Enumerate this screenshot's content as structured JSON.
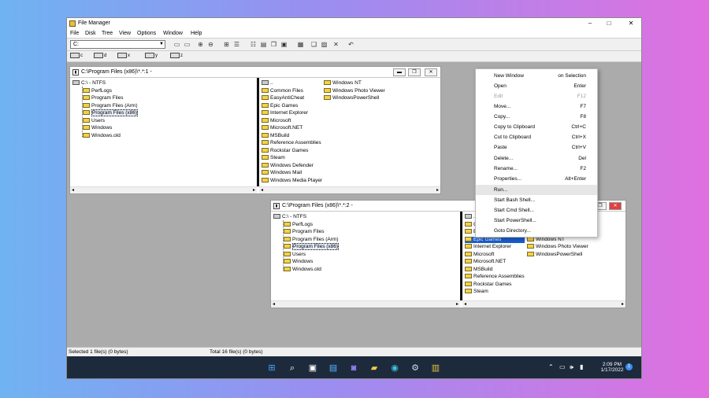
{
  "window": {
    "title": "File Manager",
    "controls": {
      "minimize": "–",
      "maximize": "□",
      "close": "✕"
    }
  },
  "menubar": [
    "File",
    "Disk",
    "Tree",
    "View",
    "Options",
    "Window",
    "Help"
  ],
  "toolbar": {
    "drive_value": "C:",
    "buttons": [
      "drive-connect-icon",
      "drive-disconnect-icon",
      "network-connect-icon",
      "network-disconnect-icon",
      "tree-view-icon",
      "split-view-icon",
      "list-view-icon",
      "details-view-icon",
      "copy-icon",
      "move-icon",
      "rename-icon",
      "delete-icon",
      "undo-icon"
    ]
  },
  "drives": [
    "c",
    "d",
    "x",
    "y",
    "z"
  ],
  "window1": {
    "title": "C:\\Program Files (x86)\\*.*:1 -",
    "tree_root": "C:\\ - NTFS",
    "tree": [
      "PerfLogs",
      "Program Files",
      "Program Files (Arm)",
      "Program Files (x86)",
      "Users",
      "Windows",
      "Windows.old"
    ],
    "selected_tree": "Program Files (x86)",
    "files_col1": [
      "..",
      "Common Files",
      "EasyAntiCheat",
      "Epic Games",
      "Internet Explorer",
      "Microsoft",
      "Microsoft.NET",
      "MSBuild",
      "Reference Assemblies",
      "Rockstar Games",
      "Steam",
      "Windows Defender",
      "Windows Mail",
      "Windows Media Player"
    ],
    "files_col2": [
      "Windows NT",
      "Windows Photo Viewer",
      "WindowsPowerShell"
    ]
  },
  "window2": {
    "title": "C:\\Program Files (x86)\\*.*:2 -",
    "tree_root": "C:\\ - NTFS",
    "tree": [
      "PerfLogs",
      "Program Files",
      "Program Files (Arm)",
      "Program Files (x86)",
      "Users",
      "Windows",
      "Windows.old"
    ],
    "selected_tree": "Program Files (x86)",
    "files_col1": [
      "..",
      "C",
      "E",
      "Epic Games",
      "Internet Explorer",
      "Microsoft",
      "Microsoft.NET",
      "MSBuild",
      "Reference Assemblies",
      "Rockstar Games",
      "Steam"
    ],
    "highlighted_file": "Epic Games",
    "files_col2": [
      "Windows NT",
      "Windows Photo Viewer",
      "WindowsPowerShell"
    ]
  },
  "context_menu": [
    {
      "label": "New Window",
      "shortcut": "on Selection",
      "disabled": false
    },
    {
      "label": "Open",
      "shortcut": "Enter",
      "disabled": false
    },
    {
      "label": "Edit",
      "shortcut": "F12",
      "disabled": true
    },
    {
      "label": "Move...",
      "shortcut": "F7",
      "disabled": false
    },
    {
      "label": "Copy...",
      "shortcut": "F8",
      "disabled": false
    },
    {
      "label": "Copy to Clipboard",
      "shortcut": "Ctrl+C",
      "disabled": false
    },
    {
      "label": "Cut to Clipboard",
      "shortcut": "Ctrl+X",
      "disabled": false
    },
    {
      "label": "Paste",
      "shortcut": "Ctrl+V",
      "disabled": false
    },
    {
      "label": "Delete...",
      "shortcut": "Del",
      "disabled": false
    },
    {
      "label": "Rename...",
      "shortcut": "F2",
      "disabled": false
    },
    {
      "label": "Properties...",
      "shortcut": "Alt+Enter",
      "disabled": false
    },
    {
      "label": "Run...",
      "shortcut": "",
      "disabled": false
    },
    {
      "label": "Start Bash Shell...",
      "shortcut": "",
      "disabled": false
    },
    {
      "label": "Start Cmd Shell...",
      "shortcut": "",
      "disabled": false
    },
    {
      "label": "Start PowerShell...",
      "shortcut": "",
      "disabled": false
    },
    {
      "label": "Goto Directory...",
      "shortcut": "",
      "disabled": false
    }
  ],
  "context_hover_index": 11,
  "status": {
    "left": "Selected 1 file(s) (0 bytes)",
    "right": "Total 16 file(s) (0 bytes)"
  },
  "taskbar": {
    "icons": [
      "start-icon",
      "search-icon",
      "task-view-icon",
      "widgets-icon",
      "chat-icon",
      "explorer-icon",
      "edge-icon",
      "steam-icon",
      "file-manager-icon"
    ],
    "time": "2:09 PM",
    "date": "1/17/2022"
  },
  "colors": {
    "selection": "#1a5fd0",
    "folder": "#f2d24a",
    "taskbar": "#1c2a3c"
  }
}
